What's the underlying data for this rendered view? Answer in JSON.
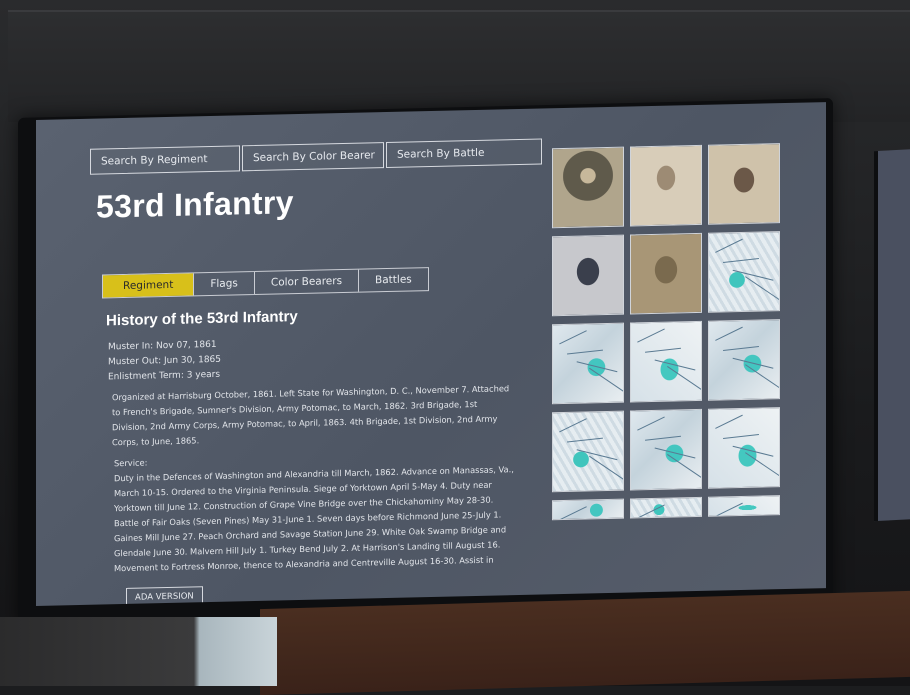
{
  "search_tabs": [
    {
      "label": "Search By Regiment"
    },
    {
      "label": "Search By Color Bearer"
    },
    {
      "label": "Search By Battle"
    }
  ],
  "title": "53rd Infantry",
  "sub_tabs": [
    {
      "label": "Regiment",
      "active": true
    },
    {
      "label": "Flags",
      "active": false
    },
    {
      "label": "Color Bearers",
      "active": false
    },
    {
      "label": "Battles",
      "active": false
    }
  ],
  "history": {
    "heading": "History of the 53rd Infantry",
    "muster_in": "Muster In: Nov 07, 1861",
    "muster_out": "Muster Out: Jun 30, 1865",
    "enlistment_term": "Enlistment Term: 3 years",
    "organized": "Organized at Harrisburg October, 1861. Left State for Washington, D. C., November 7. Attached to French's Brigade, Sumner's Division, Army Potomac, to March, 1862. 3rd Brigade, 1st Division, 2nd Army Corps, Army Potomac, to April, 1863. 4th Brigade, 1st Division, 2nd Army Corps, to June, 1865.",
    "service_label": "Service:",
    "service_text": "Duty in the Defences of Washington and Alexandria till March, 1862. Advance on Manassas, Va., March 10-15. Ordered to the Virginia Peninsula. Siege of Yorktown April 5-May 4. Duty near Yorktown till June 12. Construction of Grape Vine Bridge over the Chickahominy May 28-30. Battle of Fair Oaks (Seven Pines) May 31-June 1. Seven days before Richmond June 25-July 1. Gaines Mill June 27. Peach Orchard and Savage Station June 29. White Oak Swamp Bridge and Glendale June 30. Malvern Hill July 1. Turkey Bend July 2. At Harrison's Landing till August 16. Movement to Fortress Monroe, thence to Alexandria and Centreville August 16-30. Assist in"
  },
  "ada_button": "ADA VERSION",
  "thumbnails": [
    {
      "kind": "portrait",
      "style": "portrait-a"
    },
    {
      "kind": "portrait",
      "style": "portrait-b"
    },
    {
      "kind": "portrait",
      "style": "portrait-c"
    },
    {
      "kind": "portrait",
      "style": "portrait-d"
    },
    {
      "kind": "portrait",
      "style": "portrait-e"
    },
    {
      "kind": "map",
      "style": "map-b"
    },
    {
      "kind": "map",
      "style": "map-a"
    },
    {
      "kind": "map",
      "style": "map-c"
    },
    {
      "kind": "map",
      "style": "map-a"
    },
    {
      "kind": "map",
      "style": "map-b"
    },
    {
      "kind": "map",
      "style": "map-a"
    },
    {
      "kind": "map",
      "style": "map-c"
    },
    {
      "kind": "map",
      "style": "map-a"
    },
    {
      "kind": "map",
      "style": "map-b"
    },
    {
      "kind": "map",
      "style": "map-c"
    }
  ],
  "colors": {
    "accent": "#d8c01a",
    "screen_bg": "#545c69",
    "text": "#e2e5ea"
  }
}
